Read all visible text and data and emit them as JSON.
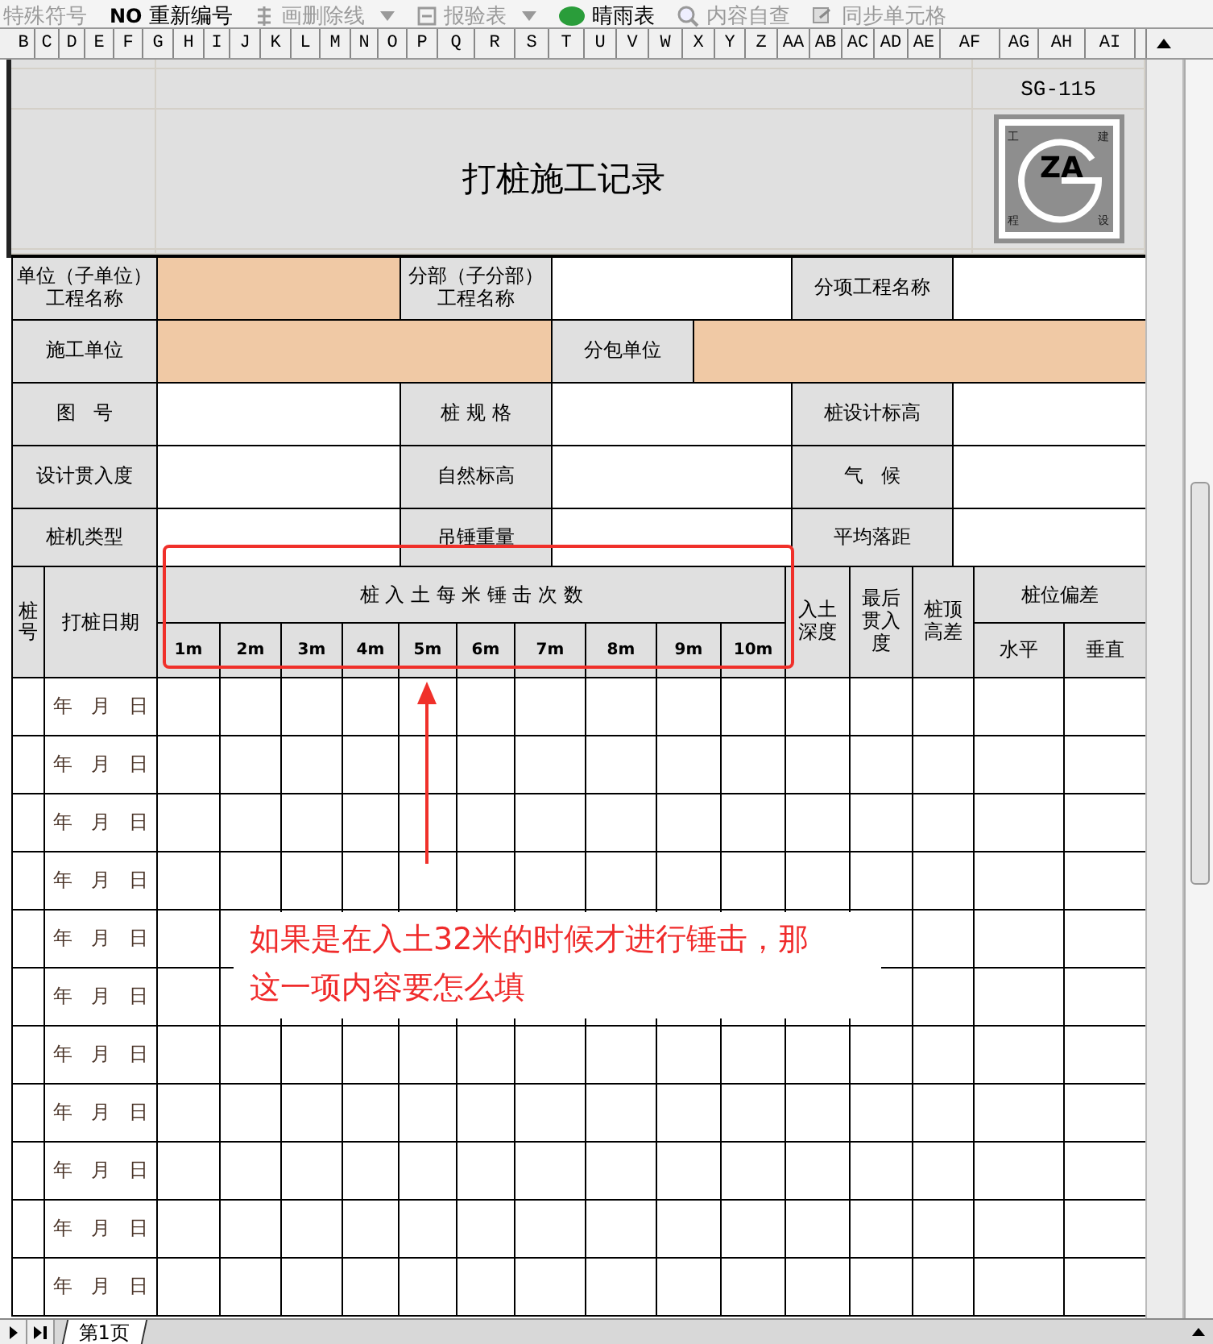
{
  "toolbar": [
    {
      "label": "特殊符号",
      "disabled": true,
      "dropdown": false
    },
    {
      "badge": "NO",
      "label": "重新编号",
      "disabled": false,
      "dropdown": false
    },
    {
      "label": "画删除线",
      "disabled": true,
      "dropdown": true
    },
    {
      "label": "报验表",
      "disabled": true,
      "dropdown": true
    },
    {
      "label": "晴雨表",
      "disabled": false,
      "dropdown": false
    },
    {
      "label": "内容自查",
      "disabled": true,
      "dropdown": false
    },
    {
      "label": "同步单元格",
      "disabled": true,
      "dropdown": false
    }
  ],
  "column_headers": [
    "B",
    "C",
    "D",
    "E",
    "F",
    "G",
    "H",
    "I",
    "J",
    "K",
    "L",
    "M",
    "N",
    "O",
    "P",
    "Q",
    "R",
    "S",
    "T",
    "U",
    "V",
    "W",
    "X",
    "Y",
    "Z",
    "AA",
    "AB",
    "AC",
    "AD",
    "AE",
    "AF",
    "AG",
    "AH",
    "AI"
  ],
  "form": {
    "code": "SG-115",
    "title": "打桩施工记录",
    "logo": {
      "letters": "ZA",
      "corners": [
        "工",
        "建",
        "程",
        "设"
      ]
    },
    "info_rows": [
      [
        {
          "kind": "label",
          "text": "单位（子单位）工程名称"
        },
        {
          "kind": "input",
          "highlighted": true
        },
        {
          "kind": "label",
          "text": "分部（子分部）工程名称"
        },
        {
          "kind": "input",
          "highlighted": false
        },
        {
          "kind": "label",
          "text": "分项工程名称"
        },
        {
          "kind": "input",
          "highlighted": false
        }
      ],
      [
        {
          "kind": "label",
          "text": "施工单位"
        },
        {
          "kind": "input",
          "highlighted": true
        },
        {
          "kind": "label",
          "text": "分包单位"
        },
        {
          "kind": "input",
          "highlighted": true
        }
      ],
      [
        {
          "kind": "label",
          "text": "图   号"
        },
        {
          "kind": "input",
          "highlighted": false
        },
        {
          "kind": "label",
          "text": "桩 规 格"
        },
        {
          "kind": "input",
          "highlighted": false
        },
        {
          "kind": "label",
          "text": "桩设计标高"
        },
        {
          "kind": "input",
          "highlighted": false
        }
      ],
      [
        {
          "kind": "label",
          "text": "设计贯入度"
        },
        {
          "kind": "input",
          "highlighted": false
        },
        {
          "kind": "label",
          "text": "自然标高"
        },
        {
          "kind": "input",
          "highlighted": false
        },
        {
          "kind": "label",
          "text": "气   候"
        },
        {
          "kind": "input",
          "highlighted": false
        }
      ],
      [
        {
          "kind": "label",
          "text": "桩机类型"
        },
        {
          "kind": "input",
          "highlighted": false
        },
        {
          "kind": "label",
          "text": "吊锤重量"
        },
        {
          "kind": "input",
          "highlighted": false
        },
        {
          "kind": "label",
          "text": "平均落距"
        },
        {
          "kind": "input",
          "highlighted": false
        }
      ]
    ],
    "blow_table": {
      "pile_no": "桩号",
      "date": "打桩日期",
      "blows": "桩 入 土 每 米 锤 击 次 数",
      "depths": [
        "1m",
        "2m",
        "3m",
        "4m",
        "5m",
        "6m",
        "7m",
        "8m",
        "9m",
        "10m"
      ],
      "penetration_depth": "入土深度",
      "last_set": "最后贯入度",
      "head_diff": "桩顶高差",
      "deviation": "桩位偏差",
      "deviation_cols": [
        "水平",
        "垂直"
      ],
      "rows": [
        {
          "date": "年   月   日"
        },
        {
          "date": "年   月   日"
        },
        {
          "date": "年   月   日"
        },
        {
          "date": "年   月   日"
        },
        {
          "date": "年   月   日"
        },
        {
          "date": "年   月   日"
        },
        {
          "date": "年   月   日"
        },
        {
          "date": "年   月   日"
        },
        {
          "date": "年   月   日"
        },
        {
          "date": "年   月   日"
        },
        {
          "date": "年   月   日"
        }
      ]
    }
  },
  "annotation": {
    "note": "如果是在入土32米的时候才进行锤击，那这一项内容要怎么填"
  },
  "sheet_tabs": [
    {
      "label": "第1页",
      "selected": true
    }
  ]
}
